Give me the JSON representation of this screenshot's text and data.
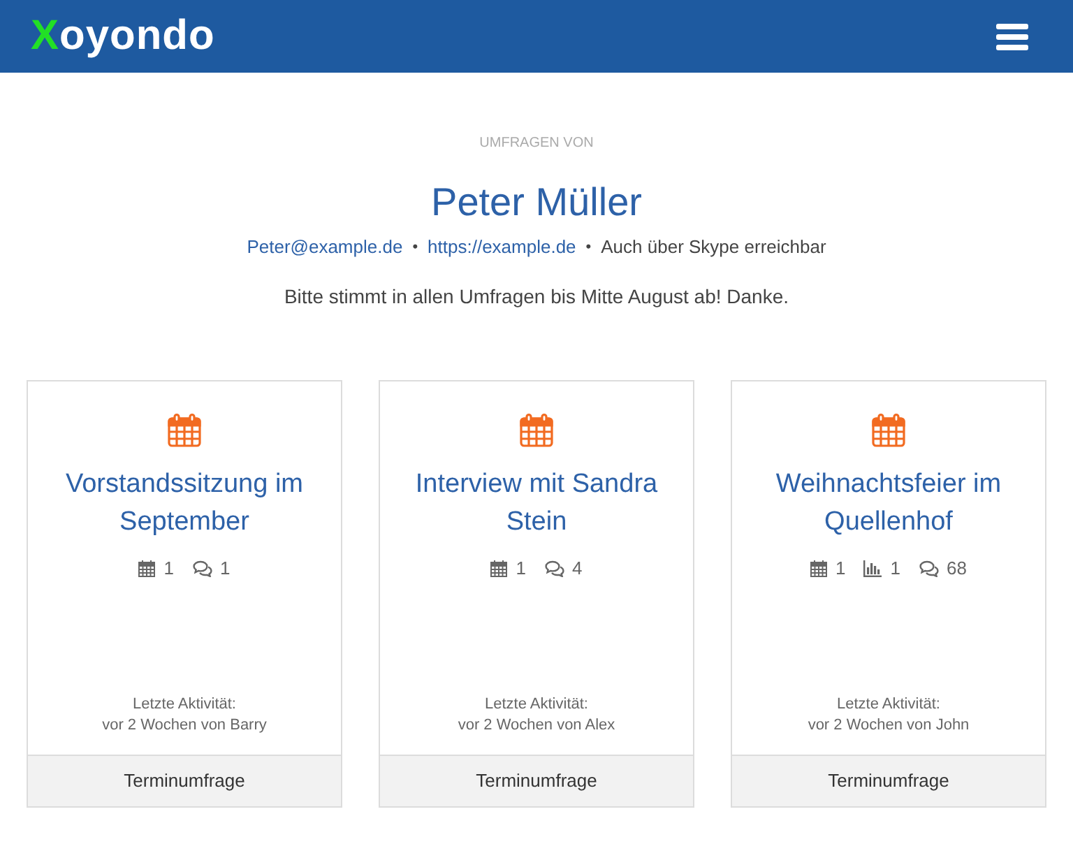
{
  "header": {
    "logo": {
      "accent": "X",
      "rest": "oyondo"
    }
  },
  "profile": {
    "label": "UMFRAGEN VON",
    "name": "Peter Müller",
    "contact": [
      {
        "kind": "link",
        "text": "Peter@example.de"
      },
      {
        "kind": "separator",
        "text": "•"
      },
      {
        "kind": "link",
        "text": "https://example.de"
      },
      {
        "kind": "separator",
        "text": "•"
      },
      {
        "kind": "text",
        "text": "Auch über Skype erreichbar"
      }
    ],
    "message": "Bitte stimmt in allen Umfragen bis Mitte August ab! Danke."
  },
  "polls": [
    {
      "title": "Vorstandssitzung im September",
      "stats": [
        {
          "kind": "dates",
          "value": "1"
        },
        {
          "kind": "comments",
          "value": "1"
        }
      ],
      "activity_label": "Letzte Aktivität:",
      "activity": "vor 2 Wochen von Barry",
      "type": "Terminumfrage"
    },
    {
      "title": "Interview mit Sandra Stein",
      "stats": [
        {
          "kind": "dates",
          "value": "1"
        },
        {
          "kind": "comments",
          "value": "4"
        }
      ],
      "activity_label": "Letzte Aktivität:",
      "activity": "vor 2 Wochen von Alex",
      "type": "Terminumfrage"
    },
    {
      "title": "Weihnachtsfeier im Quellenhof",
      "stats": [
        {
          "kind": "dates",
          "value": "1"
        },
        {
          "kind": "votes",
          "value": "1"
        },
        {
          "kind": "comments",
          "value": "68"
        }
      ],
      "activity_label": "Letzte Aktivität:",
      "activity": "vor 2 Wochen von John",
      "type": "Terminumfrage"
    }
  ]
}
